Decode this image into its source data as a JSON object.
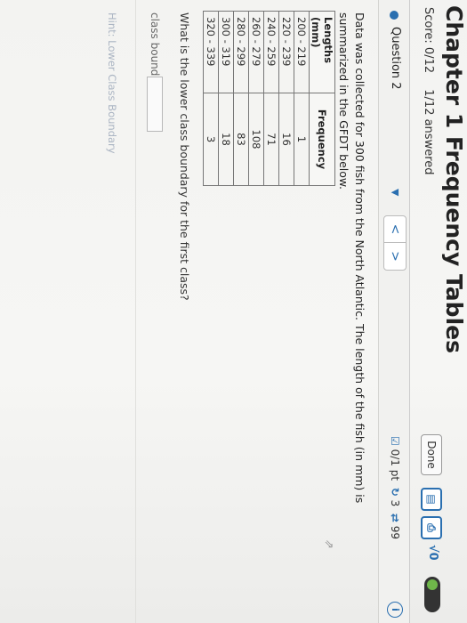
{
  "header": {
    "title": "Chapter 1 Frequency Tables",
    "score": "Score: 0/12",
    "answered": "1/12 answered",
    "done_label": "Done",
    "tool_1": "▤",
    "tool_2": "⎙",
    "sqrt_label": "√0"
  },
  "question_bar": {
    "question_label": "Question 2",
    "dropdown_glyph": "▼",
    "prev_glyph": "<",
    "next_glyph": ">",
    "points": "0/1 pt",
    "retries": "3",
    "attempts": "99",
    "check_icon": "☑",
    "retry_icon": "↻",
    "sync_icon": "⇄",
    "info_glyph": "i"
  },
  "problem": {
    "text": "Data was collected for 300 fish from the North Atlantic. The length of the fish (in mm) is summarized in the GFDT below.",
    "table": {
      "headers": [
        "Lengths (mm)",
        "Frequency"
      ],
      "rows": [
        [
          "200 - 219",
          "1"
        ],
        [
          "220 - 239",
          "16"
        ],
        [
          "240 - 259",
          "71"
        ],
        [
          "260 - 279",
          "108"
        ],
        [
          "280 - 299",
          "83"
        ],
        [
          "300 - 319",
          "18"
        ],
        [
          "320 - 339",
          "3"
        ]
      ]
    },
    "prompt": "What is the lower class boundary for the first class?",
    "answer_label": "class boundary =",
    "answer_value": "",
    "hint": "Hint: Lower Class Boundary"
  },
  "colors": {
    "accent": "#2a6fb0",
    "toggle_on": "#6fb64a"
  }
}
